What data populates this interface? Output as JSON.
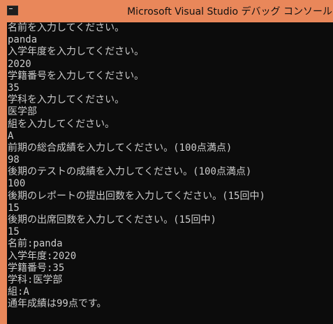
{
  "window": {
    "title": "Microsoft Visual Studio デバッグ コンソール"
  },
  "console": {
    "lines": [
      "名前を入力してください。",
      "panda",
      "入学年度を入力してください。",
      "2020",
      "学籍番号を入力してください。",
      "35",
      "学科を入力してください。",
      "医学部",
      "組を入力してください。",
      "A",
      "前期の総合成績を入力してください。(100点満点)",
      "98",
      "後期のテストの成績を入力してください。(100点満点)",
      "100",
      "後期のレポートの提出回数を入力してください。(15回中)",
      "15",
      "後期の出席回数を入力してください。(15回中)",
      "15",
      "名前:panda",
      "入学年度:2020",
      "学籍番号:35",
      "学科:医学部",
      "組:A",
      "通年成績は99点です。"
    ]
  },
  "colors": {
    "titlebar": "#e9875a",
    "console_background": "#0c0c0c",
    "console_text": "#cccccc"
  }
}
